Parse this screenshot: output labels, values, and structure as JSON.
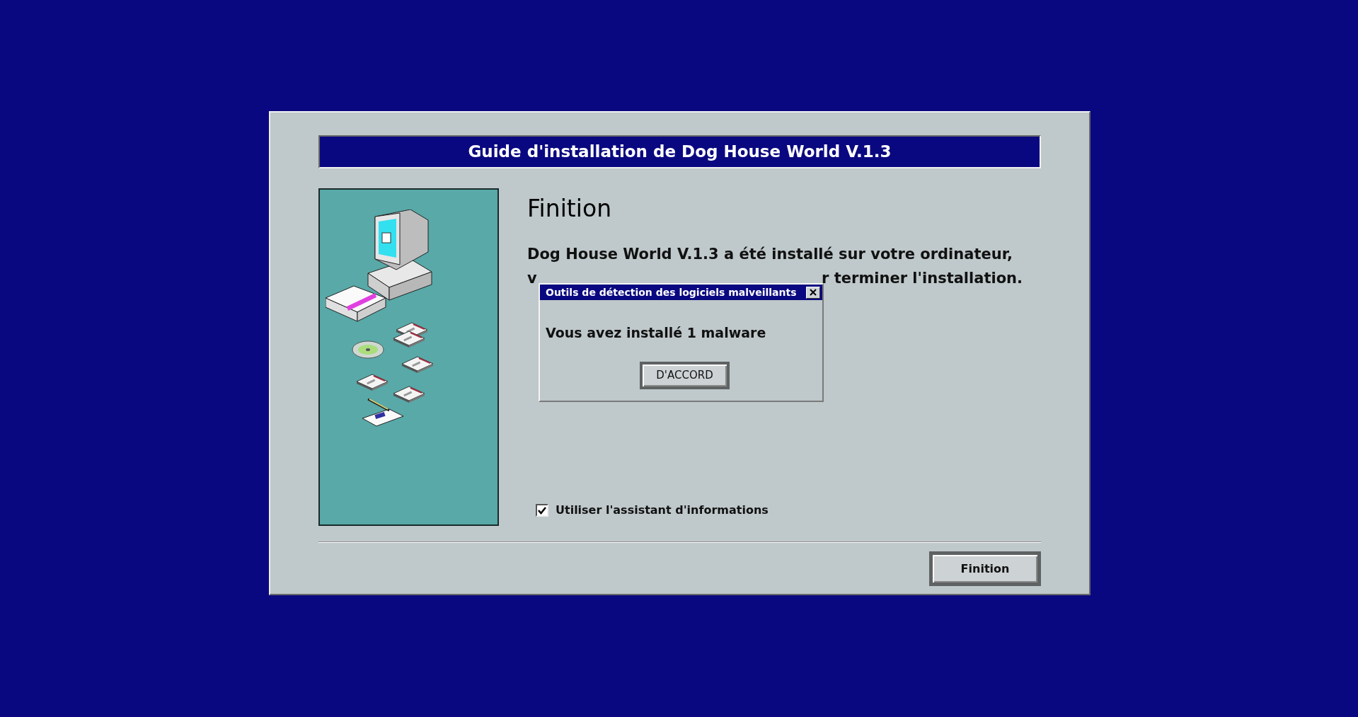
{
  "installer": {
    "title": "Guide d'installation de Dog House World V.1.3",
    "heading": "Finition",
    "message_line": "Dog House World V.1.3 a été installé sur votre ordinateur,",
    "message_fragments": [
      "v",
      "r terminer l'installation."
    ],
    "checkbox": {
      "label": "Utiliser l'assistant d'informations",
      "checked": true
    },
    "finish_button": "Finition"
  },
  "alert": {
    "title": "Outils de détection des logiciels malveillants",
    "message": "Vous avez installé 1 malware",
    "ok_button": "D'ACCORD"
  }
}
